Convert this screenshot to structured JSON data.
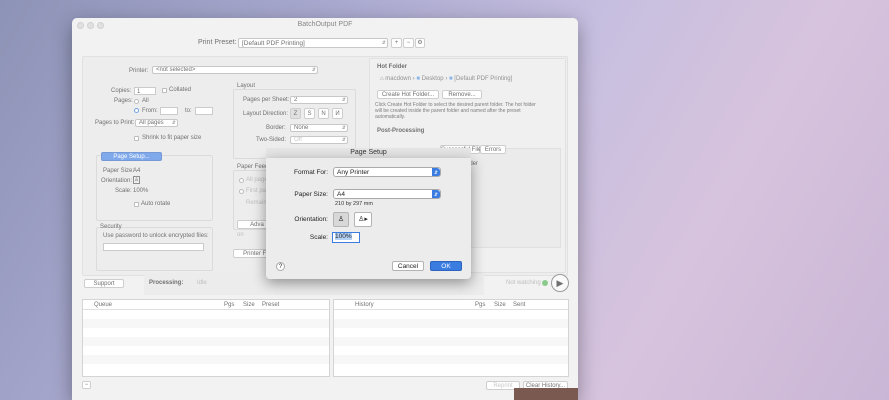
{
  "window": {
    "title": "BatchOutput PDF"
  },
  "preset": {
    "label": "Print Preset:",
    "value": "[Default PDF Printing]",
    "add": "+",
    "remove": "−",
    "gear": "⚙"
  },
  "left": {
    "printer_label": "Printer:",
    "printer_value": "<not selected>",
    "copies_label": "Copies:",
    "copies_value": "1",
    "collated_label": "Collated",
    "pages_label": "Pages:",
    "all_label": "All",
    "from_label": "From:",
    "to_label": "to:",
    "pages_to_print_label": "Pages to Print:",
    "pages_to_print_value": "All pages",
    "shrink_label": "Shrink to fit paper size",
    "page_setup_button": "Page Setup...",
    "paper_size_label": "Paper Size:",
    "paper_size_value": "A4",
    "orientation_label": "Orientation:",
    "scale_label": "Scale:",
    "scale_value": "100%",
    "auto_rotate_label": "Auto rotate",
    "security_title": "Security",
    "security_label": "Use password to unlock encrypted files:"
  },
  "layout": {
    "title": "Layout",
    "pages_per_sheet_label": "Pages per Sheet:",
    "pages_per_sheet_value": "2",
    "layout_direction_label": "Layout Direction:",
    "border_label": "Border:",
    "border_value": "None",
    "two_sided_label": "Two-Sided:",
    "two_sided_value": "Off"
  },
  "paper_feed": {
    "title": "Paper Feed",
    "all_pages": "All pages",
    "first_page": "First pag",
    "remaining": "Remainin",
    "adv_button": "Adva",
    "ph": "on",
    "printer_features_button": "Printer Fea"
  },
  "hot_folder": {
    "title": "Hot Folder",
    "path": [
      "macdown",
      "Desktop",
      "[Default PDF Printing]"
    ],
    "create_button": "Create Hot Folder...",
    "remove_button": "Remove...",
    "description": "Click Create Hot Folder to select the desired parent folder. The hot folder will be created inside the parent folder and named after the preset automatically."
  },
  "post_processing": {
    "title": "Post-Processing",
    "tab_successful": "Successful Files",
    "tab_errors": "Errors",
    "folder_partial": "lder"
  },
  "bottom": {
    "support_button": "Support",
    "processing_label": "Processing:",
    "processing_value": "Idle",
    "watching_label": "Not watching"
  },
  "queue": {
    "columns": [
      "Queue",
      "Pgs",
      "Size",
      "Preset"
    ],
    "minus": "−"
  },
  "history": {
    "columns": [
      "History",
      "Pgs",
      "Size",
      "Sent"
    ],
    "reprint_button": "Reprint",
    "clear_button": "Clear History..."
  },
  "page_setup": {
    "title": "Page Setup",
    "format_for_label": "Format For:",
    "format_for_value": "Any Printer",
    "paper_size_label": "Paper Size:",
    "paper_size_value": "A4",
    "paper_dims": "210 by 297 mm",
    "orientation_label": "Orientation:",
    "scale_label": "Scale:",
    "scale_value": "100%",
    "help": "?",
    "cancel_button": "Cancel",
    "ok_button": "OK"
  },
  "colors": {
    "accent": "#3b7ce0",
    "watch_dot": "#4caf50"
  }
}
